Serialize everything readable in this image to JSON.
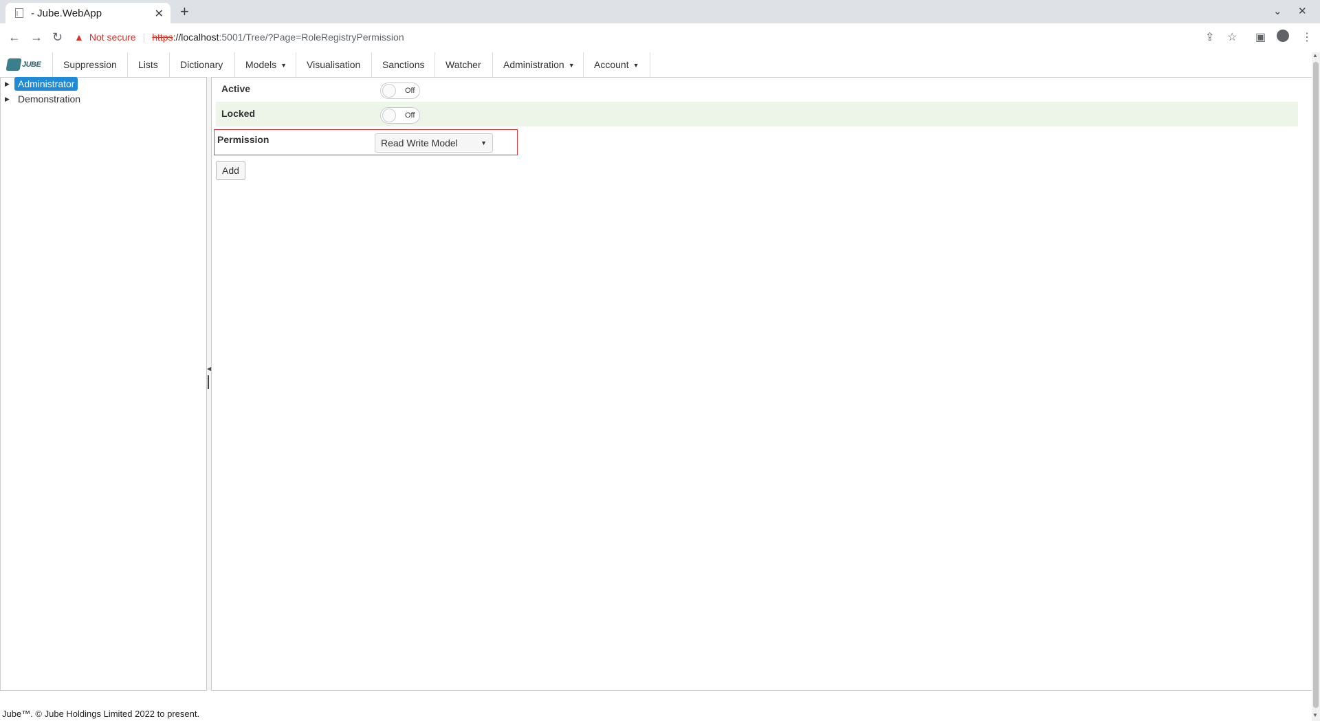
{
  "browser": {
    "tab_title": "- Jube.WebApp",
    "new_tab_icon": "plus-icon",
    "security_label": "Not secure",
    "url_scheme": "https",
    "url_host": "://localhost",
    "url_rest": ":5001/Tree/?Page=RoleRegistryPermission"
  },
  "nav": {
    "logo_text": "JUBE",
    "items": [
      {
        "label": "Suppression"
      },
      {
        "label": "Lists"
      },
      {
        "label": "Dictionary"
      },
      {
        "label": "Models",
        "dropdown": true
      },
      {
        "label": "Visualisation"
      },
      {
        "label": "Sanctions"
      },
      {
        "label": "Watcher"
      },
      {
        "label": "Administration",
        "dropdown": true
      },
      {
        "label": "Account",
        "dropdown": true
      }
    ]
  },
  "tree": {
    "nodes": [
      {
        "label": "Administrator",
        "selected": true
      },
      {
        "label": "Demonstration",
        "selected": false
      }
    ]
  },
  "form": {
    "active_label": "Active",
    "active_state": "Off",
    "locked_label": "Locked",
    "locked_state": "Off",
    "permission_label": "Permission",
    "permission_value": "Read Write Model",
    "add_label": "Add"
  },
  "footer": {
    "text": "Jube™. © Jube Holdings Limited 2022 to present."
  },
  "colors": {
    "accent": "#1f8ad6",
    "highlight_border": "#e0343c",
    "alt_row": "#edf5e9"
  }
}
